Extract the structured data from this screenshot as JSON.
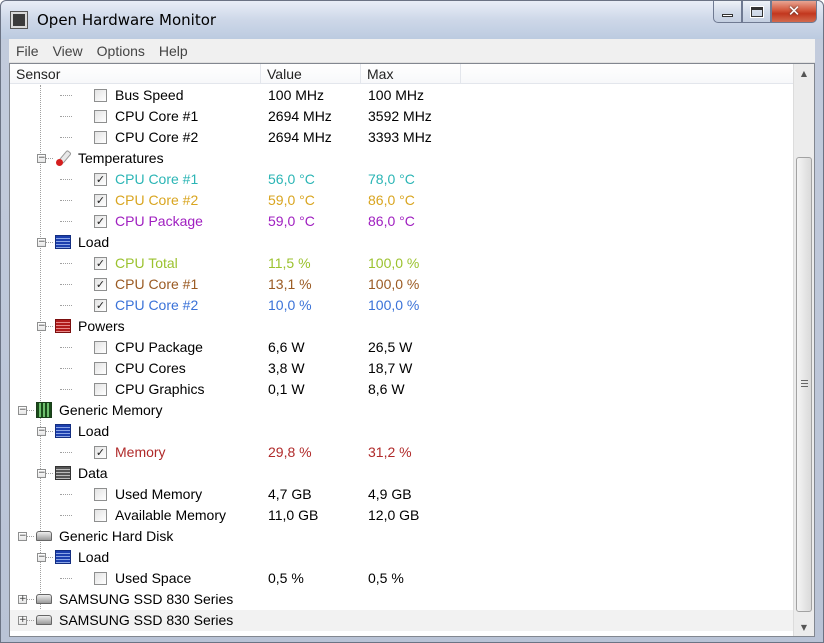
{
  "window": {
    "title": "Open Hardware Monitor"
  },
  "menu": [
    "File",
    "View",
    "Options",
    "Help"
  ],
  "columns": {
    "sensor": "Sensor",
    "value": "Value",
    "max": "Max"
  },
  "rows": [
    {
      "level": 3,
      "type": "sensor",
      "checked": false,
      "label": "Bus Speed",
      "value": "100 MHz",
      "max": "100 MHz",
      "color": "#000000"
    },
    {
      "level": 3,
      "type": "sensor",
      "checked": false,
      "label": "CPU Core #1",
      "value": "2694 MHz",
      "max": "3592 MHz",
      "color": "#000000"
    },
    {
      "level": 3,
      "type": "sensor",
      "checked": false,
      "label": "CPU Core #2",
      "value": "2694 MHz",
      "max": "3393 MHz",
      "color": "#000000"
    },
    {
      "level": 2,
      "type": "group",
      "icon": "temperature-icon",
      "label": "Temperatures"
    },
    {
      "level": 3,
      "type": "sensor",
      "checked": true,
      "label": "CPU Core #1",
      "value": "56,0 °C",
      "max": "78,0 °C",
      "color": "#2bb5b5"
    },
    {
      "level": 3,
      "type": "sensor",
      "checked": true,
      "label": "CPU Core #2",
      "value": "59,0 °C",
      "max": "86,0 °C",
      "color": "#d9a520"
    },
    {
      "level": 3,
      "type": "sensor",
      "checked": true,
      "label": "CPU Package",
      "value": "59,0 °C",
      "max": "86,0 °C",
      "color": "#a020c0"
    },
    {
      "level": 2,
      "type": "group",
      "icon": "load-icon",
      "label": "Load"
    },
    {
      "level": 3,
      "type": "sensor",
      "checked": true,
      "label": "CPU Total",
      "value": "11,5 %",
      "max": "100,0 %",
      "color": "#9bc22e"
    },
    {
      "level": 3,
      "type": "sensor",
      "checked": true,
      "label": "CPU Core #1",
      "value": "13,1 %",
      "max": "100,0 %",
      "color": "#9a5a22"
    },
    {
      "level": 3,
      "type": "sensor",
      "checked": true,
      "label": "CPU Core #2",
      "value": "10,0 %",
      "max": "100,0 %",
      "color": "#3a72d8"
    },
    {
      "level": 2,
      "type": "group",
      "icon": "power-icon",
      "label": "Powers"
    },
    {
      "level": 3,
      "type": "sensor",
      "checked": false,
      "label": "CPU Package",
      "value": "6,6 W",
      "max": "26,5 W",
      "color": "#000000"
    },
    {
      "level": 3,
      "type": "sensor",
      "checked": false,
      "label": "CPU Cores",
      "value": "3,8 W",
      "max": "18,7 W",
      "color": "#000000"
    },
    {
      "level": 3,
      "type": "sensor",
      "checked": false,
      "label": "CPU Graphics",
      "value": "0,1 W",
      "max": "8,6 W",
      "color": "#000000"
    },
    {
      "level": 1,
      "type": "hardware",
      "icon": "memory-icon",
      "label": "Generic Memory",
      "expanded": true
    },
    {
      "level": 2,
      "type": "group",
      "icon": "load-icon",
      "label": "Load"
    },
    {
      "level": 3,
      "type": "sensor",
      "checked": true,
      "label": "Memory",
      "value": "29,8 %",
      "max": "31,2 %",
      "color": "#b02a2a"
    },
    {
      "level": 2,
      "type": "group",
      "icon": "data-icon",
      "label": "Data"
    },
    {
      "level": 3,
      "type": "sensor",
      "checked": false,
      "label": "Used Memory",
      "value": "4,7 GB",
      "max": "4,9 GB",
      "color": "#000000"
    },
    {
      "level": 3,
      "type": "sensor",
      "checked": false,
      "label": "Available Memory",
      "value": "11,0 GB",
      "max": "12,0 GB",
      "color": "#000000"
    },
    {
      "level": 1,
      "type": "hardware",
      "icon": "hard-disk-icon",
      "label": "Generic Hard Disk",
      "expanded": true
    },
    {
      "level": 2,
      "type": "group",
      "icon": "load-icon",
      "label": "Load"
    },
    {
      "level": 3,
      "type": "sensor",
      "checked": false,
      "label": "Used Space",
      "value": "0,5 %",
      "max": "0,5 %",
      "color": "#000000"
    },
    {
      "level": 1,
      "type": "hardware",
      "icon": "hard-disk-icon",
      "label": "SAMSUNG SSD 830 Series",
      "expanded": false
    },
    {
      "level": 1,
      "type": "hardware",
      "icon": "hard-disk-icon",
      "label": "SAMSUNG SSD 830 Series",
      "expanded": false
    }
  ]
}
